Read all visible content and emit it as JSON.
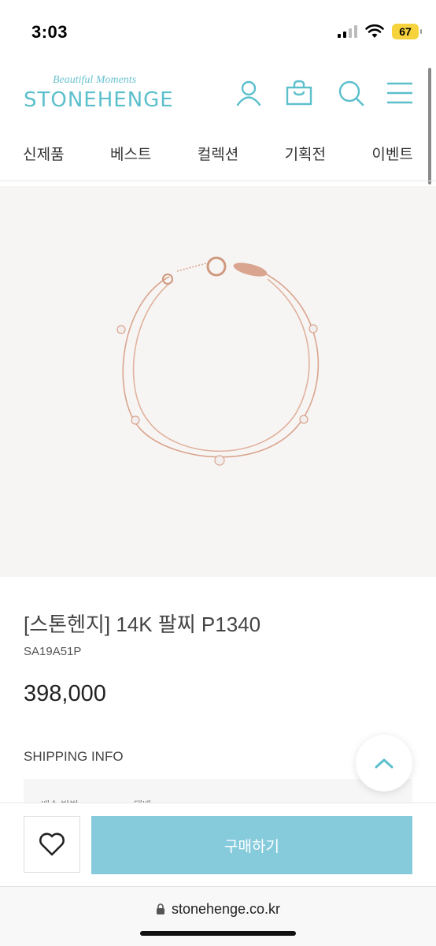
{
  "status_bar": {
    "time": "3:03",
    "battery": "67"
  },
  "header": {
    "tagline": "Beautiful Moments",
    "brand": "STONEHENGE",
    "brand_color": "#5bbfcc"
  },
  "nav": {
    "items": [
      {
        "label": "신제품"
      },
      {
        "label": "베스트"
      },
      {
        "label": "컬렉션"
      },
      {
        "label": "기획전"
      },
      {
        "label": "이벤트"
      }
    ]
  },
  "product": {
    "title": "[스톤헨지] 14K 팔찌 P1340",
    "code": "SA19A51P",
    "price": "398,000",
    "image_icon": "rose-gold-double-chain-bracelet"
  },
  "shipping": {
    "label": "SHIPPING INFO",
    "row_label": "배송 방법",
    "row_value": "택배"
  },
  "actions": {
    "wishlist_icon": "heart-icon",
    "buy_label": "구매하기",
    "buy_color": "#86cbdc"
  },
  "browser": {
    "url": "stonehenge.co.kr"
  }
}
